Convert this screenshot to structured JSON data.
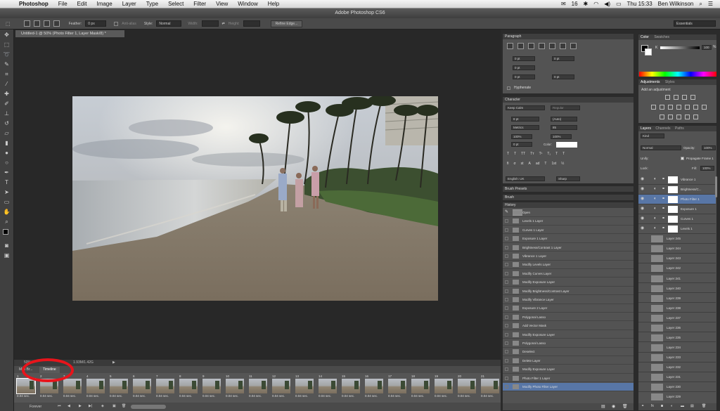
{
  "menubar": {
    "app": "Photoshop",
    "items": [
      "File",
      "Edit",
      "Image",
      "Layer",
      "Type",
      "Select",
      "Filter",
      "View",
      "Window",
      "Help"
    ],
    "badge": "16",
    "clock": "Thu 15:33",
    "user": "Ben Wilkinson"
  },
  "title": "Adobe Photoshop CS6",
  "options": {
    "feather_label": "Feather:",
    "feather_value": "0 px",
    "antialias_label": "Anti-alias",
    "style_label": "Style:",
    "style_value": "Normal",
    "width_label": "Width:",
    "height_label": "Height:",
    "refine_button": "Refine Edge...",
    "workspace": "Essentials"
  },
  "document": {
    "tab": "Untitled-1 @ 50% (Photo Filter 1, Layer Mask/8) *",
    "zoom": "50%",
    "doc_size": "1.93M/1.42G"
  },
  "timeline": {
    "tabs": [
      "Mini Br...",
      "Timeline"
    ],
    "frame_duration": "0.04 sec.",
    "frame_numbers": [
      "1",
      "2",
      "3",
      "4",
      "5",
      "6",
      "7",
      "8",
      "9",
      "10",
      "11",
      "12",
      "13",
      "14",
      "15",
      "16",
      "17",
      "18",
      "19",
      "20",
      "21"
    ],
    "loop": "Forever"
  },
  "paragraph": {
    "title": "Paragraph",
    "indent_values": [
      "0 pt",
      "0 pt",
      "0 pt",
      "0 pt",
      "0 pt"
    ],
    "hyphenate": "Hyphenate"
  },
  "character": {
    "title": "Character",
    "font": "Keep Calm",
    "style": "Regular",
    "size": "8 pt",
    "leading": "(Auto)",
    "kerning": "Metrics",
    "tracking": "85",
    "vscale": "100%",
    "hscale": "100%",
    "baseline": "0 pt",
    "color_label": "Color:",
    "language": "English: UK",
    "aa": "Sharp"
  },
  "collapsed_panels": [
    "Brush Presets",
    "Brush"
  ],
  "history": {
    "title": "History",
    "items": [
      "Open",
      "Levels 1 Layer",
      "Curves 1 Layer",
      "Exposure 1 Layer",
      "Brightness/Contrast 1 Layer",
      "Vibrance 1 Layer",
      "Modify Levels Layer",
      "Modify Curves Layer",
      "Modify Exposure Layer",
      "Modify Brightness/Contrast Layer",
      "Modify Vibrance Layer",
      "Exposure 2 Layer",
      "Polygonal Lasso",
      "Add Vector Mask",
      "Modify Exposure Layer",
      "Polygonal Lasso",
      "Deselect",
      "Delete Layer",
      "Modify Exposure Layer",
      "Photo Filter 1 Layer",
      "Modify Photo Filter Layer"
    ]
  },
  "color": {
    "tabs": [
      "Color",
      "Swatches"
    ],
    "k_label": "K",
    "k_value": "100",
    "k_unit": "%"
  },
  "adjustments": {
    "tabs": [
      "Adjustments",
      "Styles"
    ],
    "subtitle": "Add an adjustment"
  },
  "layers": {
    "tabs": [
      "Layers",
      "Channels",
      "Paths"
    ],
    "kind": "Kind",
    "blend": "Normal",
    "opacity_label": "Opacity:",
    "opacity_value": "100%",
    "unify_label": "Unify:",
    "propagate": "Propagate Frame 1",
    "lock_label": "Lock:",
    "fill_label": "Fill:",
    "fill_value": "100%",
    "items": [
      "Vibrance 1",
      "Brightness/C...",
      "Photo Filter 1",
      "Exposure 1",
      "Curves 1",
      "Levels 1",
      "Layer 245",
      "Layer 244",
      "Layer 243",
      "Layer 242",
      "Layer 241",
      "Layer 240",
      "Layer 239",
      "Layer 238",
      "Layer 237",
      "Layer 236",
      "Layer 235",
      "Layer 234",
      "Layer 233",
      "Layer 232",
      "Layer 231",
      "Layer 230",
      "Layer 229"
    ]
  },
  "colors": {
    "selection_blue": "#5876a6",
    "annotation_red": "#e8141b"
  }
}
